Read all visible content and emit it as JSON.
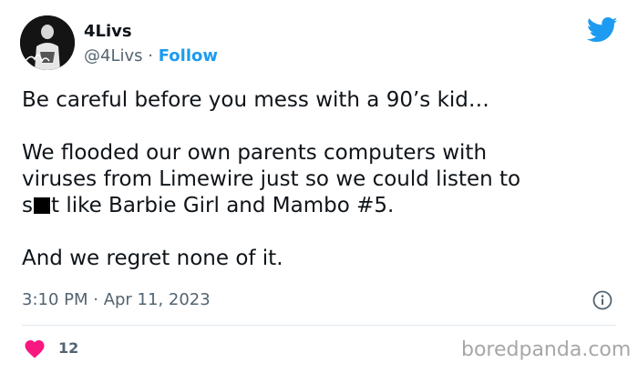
{
  "tweet": {
    "author": {
      "display_name": "4Livs",
      "handle": "@4Livs",
      "separator": "·",
      "follow_label": "Follow",
      "avatar_icon": "avatar-photo",
      "avatar_signature": "4Livs"
    },
    "brand_icon": "twitter-bird-icon",
    "brand_color": "#1d9bf0",
    "text": {
      "line1": "Be careful before you mess with a 90’s kid…",
      "line2": "We flooded our own parents computers with",
      "line3": "viruses from Limewire just so we could listen to",
      "line4_prefix": "s",
      "line4_suffix": "t like Barbie Girl and Mambo #5.",
      "line5": "And we regret none of it."
    },
    "timestamp": "3:10 PM · Apr 11, 2023",
    "info_icon": "info-icon",
    "likes": {
      "icon": "heart-icon",
      "count": "12",
      "color": "#f91880"
    }
  },
  "watermark": "boredpanda.com"
}
